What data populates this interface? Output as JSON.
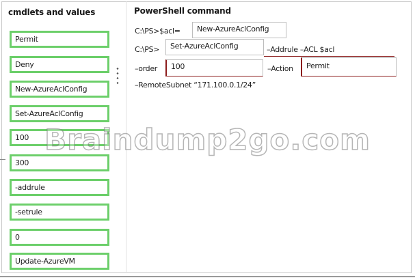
{
  "left_panel": {
    "title": "cmdlets and values",
    "options": [
      "Permit",
      "Deny",
      "New-AzureAclConfig",
      "Set-AzureAclConfig",
      "100",
      "300",
      "-addrule",
      "-setrule",
      "0",
      "Update-AzureVM"
    ]
  },
  "command_panel": {
    "title": "PowerShell command",
    "line1": {
      "prompt": "C:\\PS>$acl=",
      "slot1": "New-AzureAclConfig"
    },
    "line2": {
      "prompt": "C:\\PS>",
      "slot2": "Set-AzureAclConfig",
      "suffix": "–Addrule –ACL $acl"
    },
    "line3": {
      "order_label": "–order",
      "slot3": "100",
      "action_label": "–Action",
      "slot4": "Permit"
    },
    "line4": {
      "text": "–RemoteSubnet “171.100.0.1/24”"
    }
  },
  "watermark": "Braindump2go.com",
  "colors": {
    "option_border": "#6ccf6a",
    "slot_marker": "#8b1a1a"
  }
}
